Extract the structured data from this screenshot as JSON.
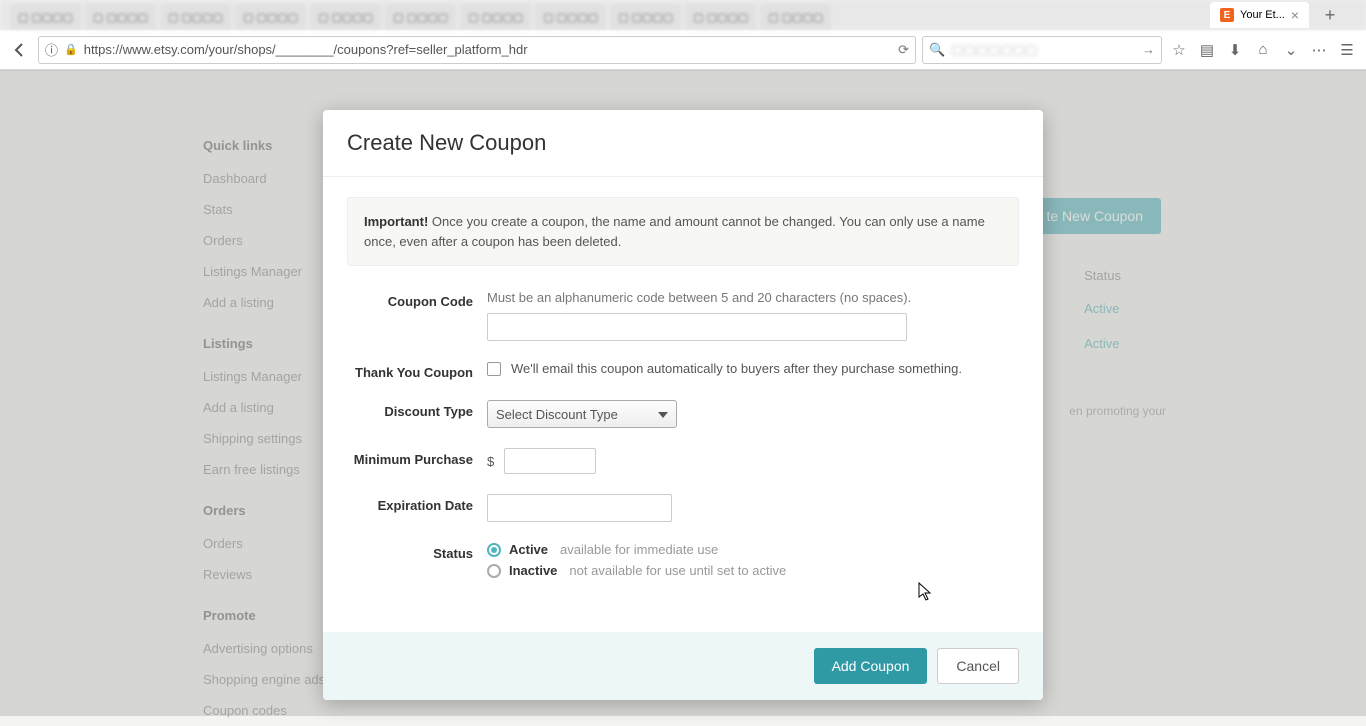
{
  "browser": {
    "active_tab_title": "Your Et...",
    "url": "https://www.etsy.com/your/shops/________/coupons?ref=seller_platform_hdr",
    "search_placeholder": "",
    "blurred_tabs": [
      "Inbox",
      "User",
      "Results",
      "Etsy",
      "Etsy",
      "admin",
      "Users",
      "Users",
      "Feed",
      "Marketing",
      "App"
    ]
  },
  "sidebar": {
    "groups": [
      {
        "title": "Quick links",
        "items": [
          "Dashboard",
          "Stats",
          "Orders",
          "Listings Manager",
          "Add a listing"
        ]
      },
      {
        "title": "Listings",
        "items": [
          "Listings Manager",
          "Add a listing",
          "Shipping settings",
          "Earn free listings"
        ]
      },
      {
        "title": "Orders",
        "items": [
          "Orders",
          "Reviews"
        ]
      },
      {
        "title": "Promote",
        "items": [
          "Advertising options",
          "Shopping engine ads",
          "Coupon codes"
        ]
      }
    ]
  },
  "background": {
    "create_button": "te New Coupon",
    "status_header": "Status",
    "status_rows": [
      "Active",
      "Active"
    ],
    "promo_snippet": "en promoting your"
  },
  "modal": {
    "title": "Create New Coupon",
    "important_label": "Important!",
    "important_text": " Once you create a coupon, the name and amount cannot be changed. You can only use a name once, even after a coupon has been deleted.",
    "fields": {
      "coupon_code": {
        "label": "Coupon Code",
        "hint": "Must be an alphanumeric code between 5 and 20 characters (no spaces)."
      },
      "thank_you": {
        "label": "Thank You Coupon",
        "text": "We'll email this coupon automatically to buyers after they purchase something."
      },
      "discount_type": {
        "label": "Discount Type",
        "selected": "Select Discount Type"
      },
      "min_purchase": {
        "label": "Minimum Purchase",
        "currency": "$"
      },
      "expiration": {
        "label": "Expiration Date"
      },
      "status": {
        "label": "Status",
        "active": {
          "name": "Active",
          "hint": "available for immediate use"
        },
        "inactive": {
          "name": "Inactive",
          "hint": "not available for use until set to active"
        }
      }
    },
    "buttons": {
      "submit": "Add Coupon",
      "cancel": "Cancel"
    }
  }
}
